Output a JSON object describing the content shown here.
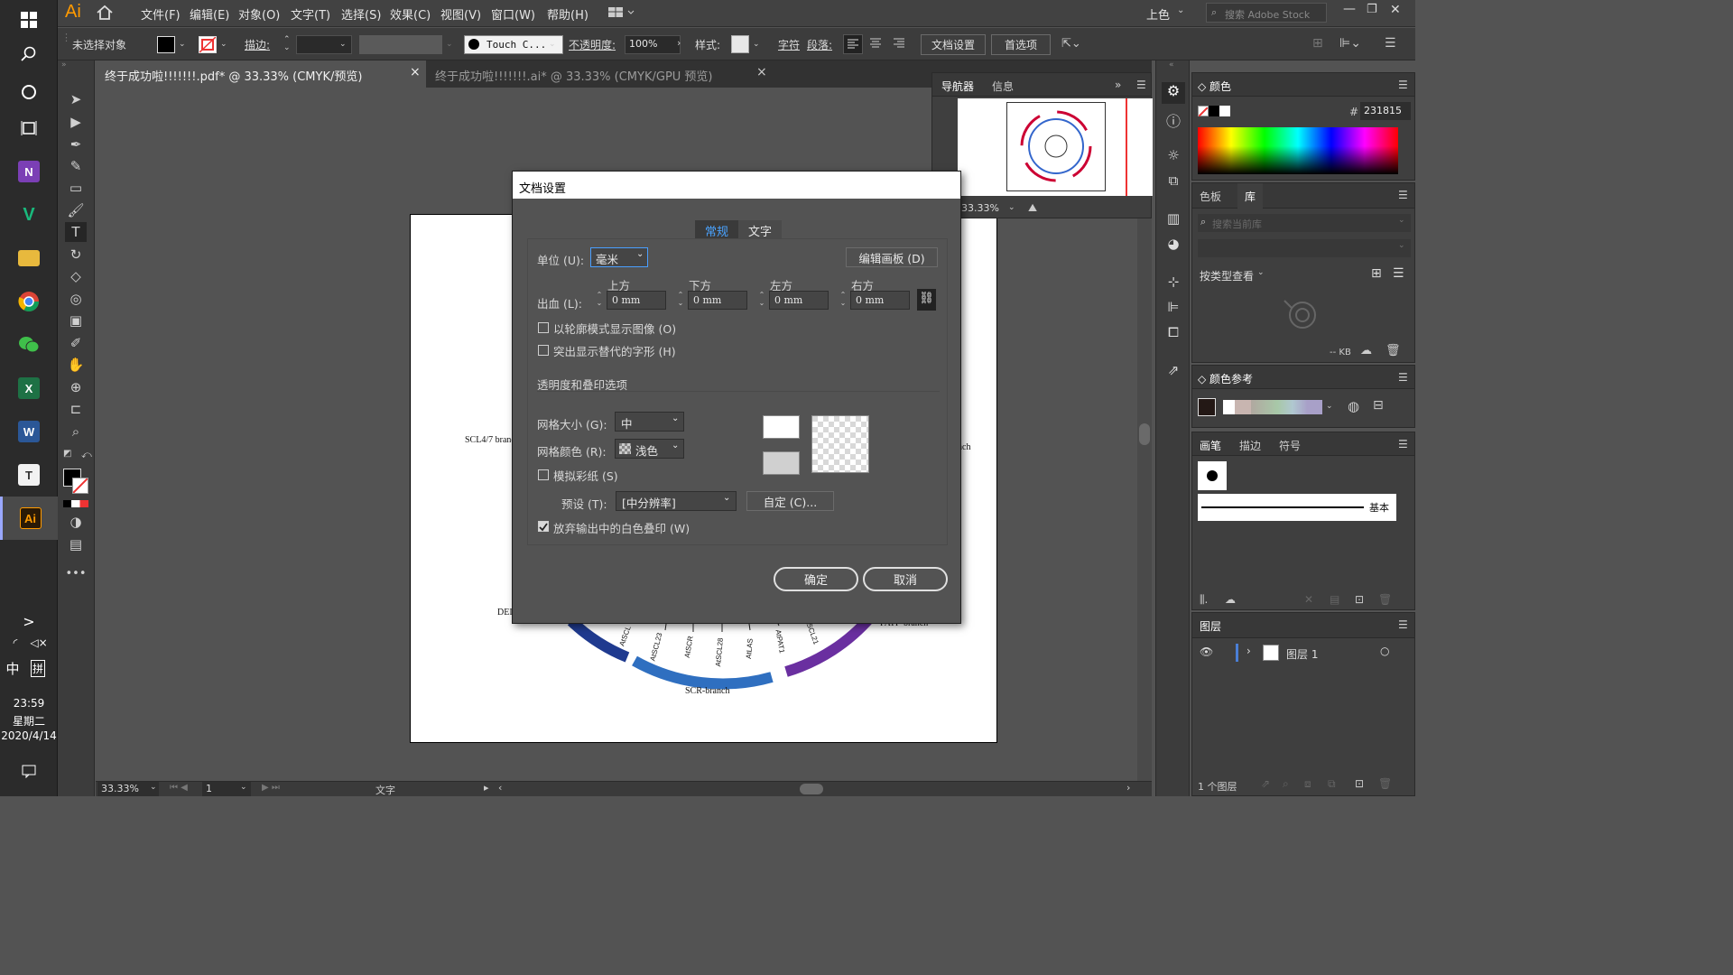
{
  "taskbar": {
    "clock": "23:59",
    "weekday": "星期二",
    "date": "2020/4/14",
    "ime_lang": "中",
    "ime_mode": "拼"
  },
  "menu": {
    "logo": "Ai",
    "items": [
      "文件(F)",
      "编辑(E)",
      "对象(O)",
      "文字(T)",
      "选择(S)",
      "效果(C)",
      "视图(V)",
      "窗口(W)",
      "帮助(H)"
    ],
    "workspace": "上色",
    "search_placeholder": "搜索 Adobe Stock"
  },
  "control": {
    "selection": "未选择对象",
    "stroke_label": "描边:",
    "brush": "Touch C...",
    "opacity_label": "不透明度:",
    "opacity_value": "100%",
    "style_label": "样式:",
    "char_label": "字符",
    "para_label": "段落:",
    "doc_setup": "文档设置",
    "prefs": "首选项"
  },
  "tabs": [
    {
      "label": "终于成功啦!!!!!!!.pdf* @ 33.33% (CMYK/预览)",
      "close": "×"
    },
    {
      "label": "终于成功啦!!!!!!!.ai* @ 33.33% (CMYK/GPU 预览)",
      "close": "×"
    }
  ],
  "artboard": {
    "labels": {
      "scl47": "SCL4/7 branch",
      "dei": "DEI",
      "pati": "PATI -branch",
      "nch": "nch",
      "scr": "SCR-branch"
    },
    "genes": [
      "AtSCL",
      "AtSCL23",
      "AtSCR",
      "AtSCL28",
      "AtLAS",
      "AtPAT1",
      "AtSCL21"
    ]
  },
  "status": {
    "zoom": "33.33%",
    "page": "1",
    "tool": "文字"
  },
  "navigator": {
    "tab_active": "导航器",
    "tab_other": "信息",
    "zoom": "33.33%"
  },
  "color_panel": {
    "title": "颜色",
    "hex_label": "#",
    "hex": "231815"
  },
  "library_panel": {
    "tab_swatch": "色板",
    "tab_library": "库",
    "search_placeholder": "搜索当前库",
    "view_by": "按类型查看",
    "size": "-- KB"
  },
  "color_guide": {
    "title": "颜色参考"
  },
  "brush_panel": {
    "tab_brush": "画笔",
    "tab_stroke": "描边",
    "tab_symbol": "符号",
    "basic": "基本"
  },
  "layers_panel": {
    "title": "图层",
    "layer_name": "图层 1",
    "count": "1 个图层"
  },
  "dialog": {
    "title": "文档设置",
    "tab_general": "常规",
    "tab_type": "文字",
    "unit_label": "单位 (U):",
    "unit_value": "毫米",
    "edit_artboards": "编辑画板 (D)",
    "bleed_label": "出血 (L):",
    "bleed_top_label": "上方",
    "bleed_bottom_label": "下方",
    "bleed_left_label": "左方",
    "bleed_right_label": "右方",
    "bleed_top": "0 mm",
    "bleed_bottom": "0 mm",
    "bleed_left": "0 mm",
    "bleed_right": "0 mm",
    "outline_images": "以轮廓模式显示图像 (O)",
    "highlight_glyphs": "突出显示替代的字形 (H)",
    "transparency_heading": "透明度和叠印选项",
    "grid_size_label": "网格大小 (G):",
    "grid_size_value": "中",
    "grid_color_label": "网格颜色 (R):",
    "grid_color_value": "浅色",
    "simulate_paper": "模拟彩纸 (S)",
    "preset_label": "预设 (T):",
    "preset_value": "[中分辨率]",
    "custom": "自定 (C)...",
    "discard_white": "放弃输出中的白色叠印 (W)",
    "ok": "确定",
    "cancel": "取消",
    "checks": {
      "outline_images": false,
      "highlight_glyphs": false,
      "simulate_paper": false,
      "discard_white": true
    }
  },
  "colors": {
    "accent": "#4a7fd6",
    "scr_branch": "#2f6fc0",
    "dark_branch": "#1f3a8f",
    "pati_branch": "#6a2fa0"
  }
}
